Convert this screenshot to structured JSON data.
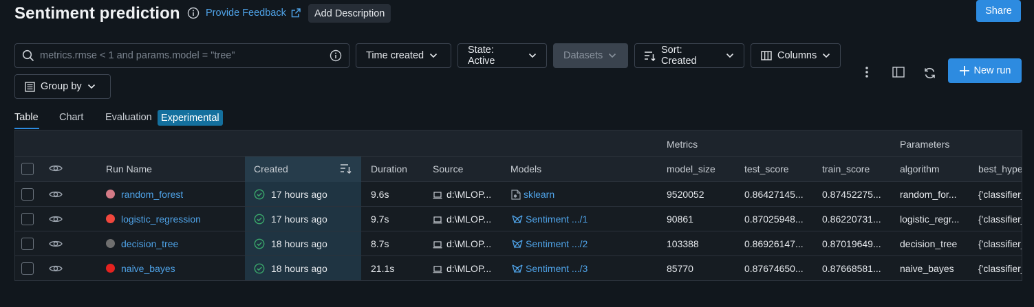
{
  "header": {
    "title": "Sentiment prediction",
    "feedback_label": "Provide Feedback",
    "add_description_label": "Add Description",
    "share_label": "Share"
  },
  "toolbar": {
    "search_placeholder": "metrics.rmse < 1 and params.model = \"tree\"",
    "time_created_label": "Time created",
    "state_label": "State: Active",
    "datasets_label": "Datasets",
    "sort_label": "Sort: Created",
    "columns_label": "Columns",
    "group_by_label": "Group by",
    "new_run_label": "New run"
  },
  "tabs": [
    {
      "label": "Table",
      "active": true
    },
    {
      "label": "Chart",
      "active": false
    },
    {
      "label": "Evaluation",
      "active": false
    }
  ],
  "experimental_badge": "Experimental",
  "table": {
    "group_headers": {
      "metrics": "Metrics",
      "parameters": "Parameters"
    },
    "columns": {
      "run_name": "Run Name",
      "created": "Created",
      "duration": "Duration",
      "source": "Source",
      "models": "Models",
      "model_size": "model_size",
      "test_score": "test_score",
      "train_score": "train_score",
      "algorithm": "algorithm",
      "best_hyper": "best_hype"
    },
    "rows": [
      {
        "run_name": "random_forest",
        "dot_color": "#d47a86",
        "created": "17 hours ago",
        "duration": "9.6s",
        "source": "d:\\MLOP...",
        "model": "sklearn",
        "model_kind": "sklearn",
        "model_size": "9520052",
        "test_score": "0.86427145...",
        "train_score": "0.87452275...",
        "algorithm": "random_for...",
        "best_hyper": "{'classifier_"
      },
      {
        "run_name": "logistic_regression",
        "dot_color": "#f1473d",
        "created": "17 hours ago",
        "duration": "9.7s",
        "source": "d:\\MLOP...",
        "model": "Sentiment .../1",
        "model_kind": "registered",
        "model_size": "90861",
        "test_score": "0.87025948...",
        "train_score": "0.86220731...",
        "algorithm": "logistic_regr...",
        "best_hyper": "{'classifier_"
      },
      {
        "run_name": "decision_tree",
        "dot_color": "#6f6f6f",
        "created": "18 hours ago",
        "duration": "8.7s",
        "source": "d:\\MLOP...",
        "model": "Sentiment .../2",
        "model_kind": "registered",
        "model_size": "103388",
        "test_score": "0.86926147...",
        "train_score": "0.87019649...",
        "algorithm": "decision_tree",
        "best_hyper": "{'classifier_"
      },
      {
        "run_name": "naive_bayes",
        "dot_color": "#e5221f",
        "created": "18 hours ago",
        "duration": "21.1s",
        "source": "d:\\MLOP...",
        "model": "Sentiment .../3",
        "model_kind": "registered",
        "model_size": "85770",
        "test_score": "0.87674650...",
        "train_score": "0.87668581...",
        "algorithm": "naive_bayes",
        "best_hyper": "{'classifier_"
      }
    ]
  },
  "colors": {
    "accent": "#2d8be0",
    "link": "#4fa3e8",
    "success": "#3aa86b",
    "background": "#11171d"
  }
}
